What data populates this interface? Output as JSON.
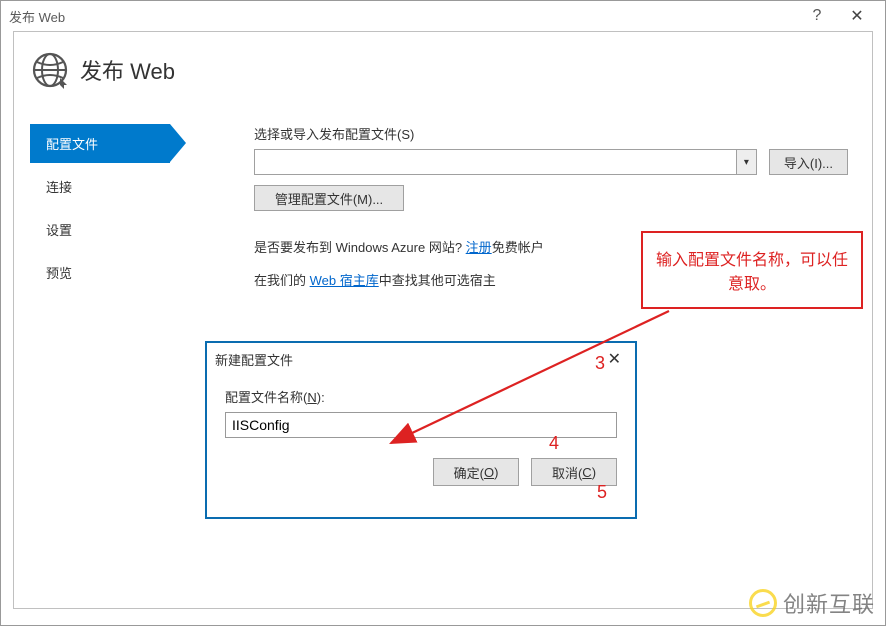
{
  "window": {
    "title": "发布 Web"
  },
  "header": {
    "title": "发布 Web"
  },
  "sidebar": {
    "items": [
      {
        "label": "配置文件"
      },
      {
        "label": "连接"
      },
      {
        "label": "设置"
      },
      {
        "label": "预览"
      }
    ]
  },
  "main": {
    "select_label": "选择或导入发布配置文件(S)",
    "combo_value": "",
    "import_label": "导入(I)...",
    "manage_label": "管理配置文件(M)...",
    "azure_prefix": "是否要发布到 Windows Azure 网站? ",
    "azure_link": "注册",
    "azure_suffix": "免费帐户",
    "host_prefix": "在我们的 ",
    "host_link": "Web 宿主库",
    "host_suffix": "中查找其他可选宿主"
  },
  "dialog": {
    "title": "新建配置文件",
    "field_label_pre": "配置文件名称(",
    "field_label_u": "N",
    "field_label_post": "):",
    "input_value": "IISConfig",
    "ok_pre": "确定(",
    "ok_u": "O",
    "ok_post": ")",
    "cancel_pre": "取消(",
    "cancel_u": "C",
    "cancel_post": ")"
  },
  "annotations": {
    "callout_text": "输入配置文件名称，可以任意取。",
    "n3": "3",
    "n4": "4",
    "n5": "5"
  },
  "watermark": {
    "text": "创新互联"
  }
}
